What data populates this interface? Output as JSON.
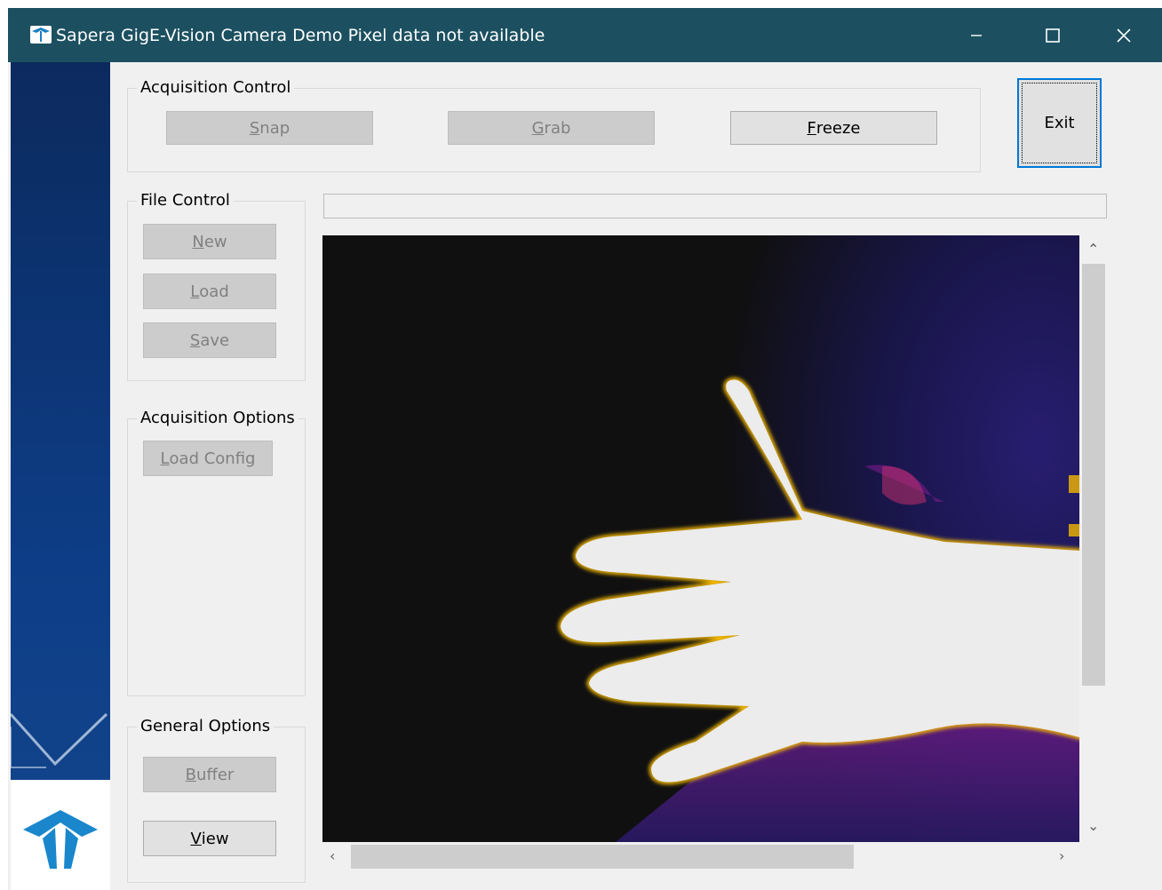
{
  "window": {
    "title": "Sapera GigE-Vision Camera Demo  Pixel data not available",
    "controls": [
      "minimize-icon",
      "maximize-icon",
      "close-icon"
    ]
  },
  "acquisition_control": {
    "legend": "Acquisition Control",
    "snap": {
      "pre": "",
      "key": "S",
      "post": "nap"
    },
    "grab": {
      "pre": "",
      "key": "G",
      "post": "rab"
    },
    "freeze": {
      "pre": "",
      "key": "F",
      "post": "reeze"
    }
  },
  "exit": {
    "pre": "",
    "key": "E",
    "post": "xit"
  },
  "file_control": {
    "legend": "File Control",
    "new": {
      "pre": "",
      "key": "N",
      "post": "ew"
    },
    "load": {
      "pre": "",
      "key": "L",
      "post": "oad"
    },
    "save": {
      "pre": "",
      "key": "S",
      "post": "ave"
    }
  },
  "acquisition_options": {
    "legend": "Acquisition Options",
    "load_config": {
      "pre": "",
      "key": "L",
      "post": "oad Config"
    }
  },
  "general_options": {
    "legend": "General Options",
    "buffer": {
      "pre": "",
      "key": "B",
      "post": "uffer"
    },
    "view": {
      "pre": "",
      "key": "V",
      "post": "iew"
    }
  },
  "colors": {
    "titlebar": "#1c5060",
    "sidebar": "#0d3d86",
    "image_background": "#101010",
    "hand": "#ececec",
    "heat_edge": "#f4b800",
    "heat_mid": "#7a1a8a",
    "heat_low": "#1b1650"
  },
  "icons": {
    "app": "teledyne-logo-icon",
    "scroll_up": "chevron-up-icon",
    "scroll_down": "chevron-down-icon",
    "scroll_left": "chevron-left-icon",
    "scroll_right": "chevron-right-icon"
  }
}
